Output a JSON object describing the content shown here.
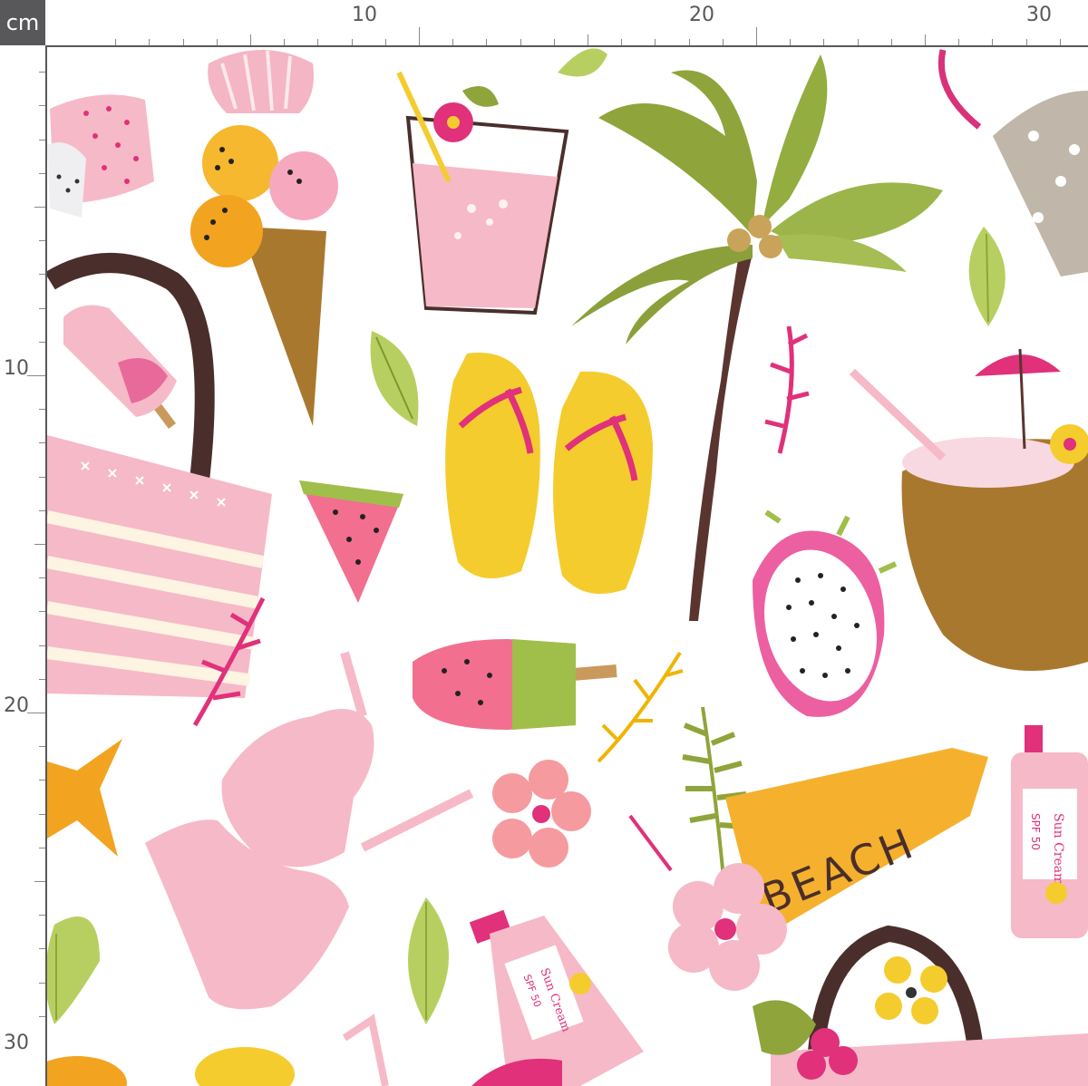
{
  "ruler": {
    "unit": "cm",
    "top_labels": [
      "10",
      "20",
      "30"
    ],
    "left_labels": [
      "10",
      "20",
      "30"
    ]
  },
  "print": {
    "sign_text": "BEACH",
    "sunscreen_label_1": "Sun Cream",
    "sunscreen_spf_1": "SPF 50",
    "sunscreen_label_2": "Sun Cream",
    "sunscreen_spf_2": "SPF 50"
  },
  "colors": {
    "ruler_dark": "#58585b",
    "pink": "#f6b9c8",
    "hot_pink": "#e0317a",
    "yellow": "#f5cc2e",
    "olive": "#8fa43a",
    "brown": "#5a3530",
    "tan": "#a9782f"
  }
}
